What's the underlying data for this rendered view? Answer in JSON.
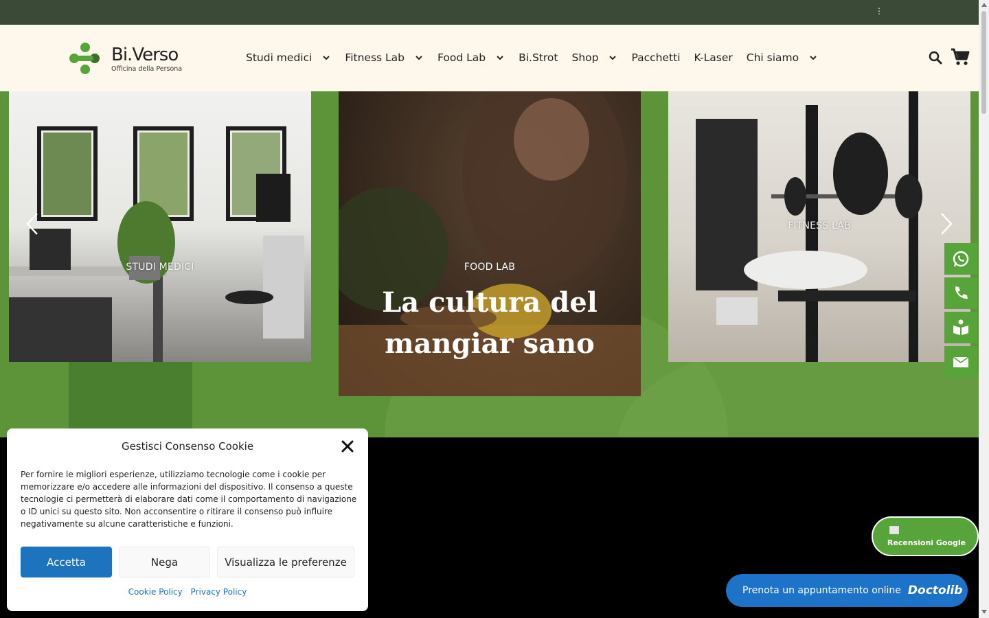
{
  "topbar": {
    "dots": "⋮"
  },
  "brand": {
    "name": "Bi.Verso",
    "tagline": "Officina della Persona",
    "color": "#57a53a"
  },
  "nav": {
    "items": [
      {
        "label": "Studi medici",
        "dropdown": true
      },
      {
        "label": "Fitness Lab",
        "dropdown": true
      },
      {
        "label": "Food Lab",
        "dropdown": true
      },
      {
        "label": "Bi.Strot",
        "dropdown": false
      },
      {
        "label": "Shop",
        "dropdown": true
      },
      {
        "label": "Pacchetti",
        "dropdown": false
      },
      {
        "label": "K-Laser",
        "dropdown": false
      },
      {
        "label": "Chi siamo",
        "dropdown": true
      }
    ]
  },
  "hero": {
    "slides": [
      {
        "label": "STUDI MEDICI"
      },
      {
        "label": "FOOD LAB",
        "headline_line1": "La cultura del",
        "headline_line2": "mangiar sano"
      },
      {
        "label": "FITNESS LAB"
      }
    ],
    "background": "#5d9439"
  },
  "side_actions": [
    "whatsapp-icon",
    "phone-icon",
    "book-icon",
    "envelope-icon"
  ],
  "cookie": {
    "title": "Gestisci Consenso Cookie",
    "text": "Per fornire le migliori esperienze, utilizziamo tecnologie come i cookie per memorizzare e/o accedere alle informazioni del dispositivo. Il consenso a queste tecnologie ci permetterà di elaborare dati come il comportamento di navigazione o ID unici su questo sito. Non acconsentire o ritirare il consenso può influire negativamente su alcune caratteristiche e funzioni.",
    "accept": "Accetta",
    "deny": "Nega",
    "preferences": "Visualizza le preferenze",
    "cookie_policy": "Cookie Policy",
    "privacy_policy": "Privacy Policy",
    "accent": "#1e73be"
  },
  "reviews": {
    "label": "Recensioni Google"
  },
  "booking": {
    "label": "Prenota un appuntamento online",
    "brand": "Doctolib",
    "color": "#1c73c8"
  }
}
